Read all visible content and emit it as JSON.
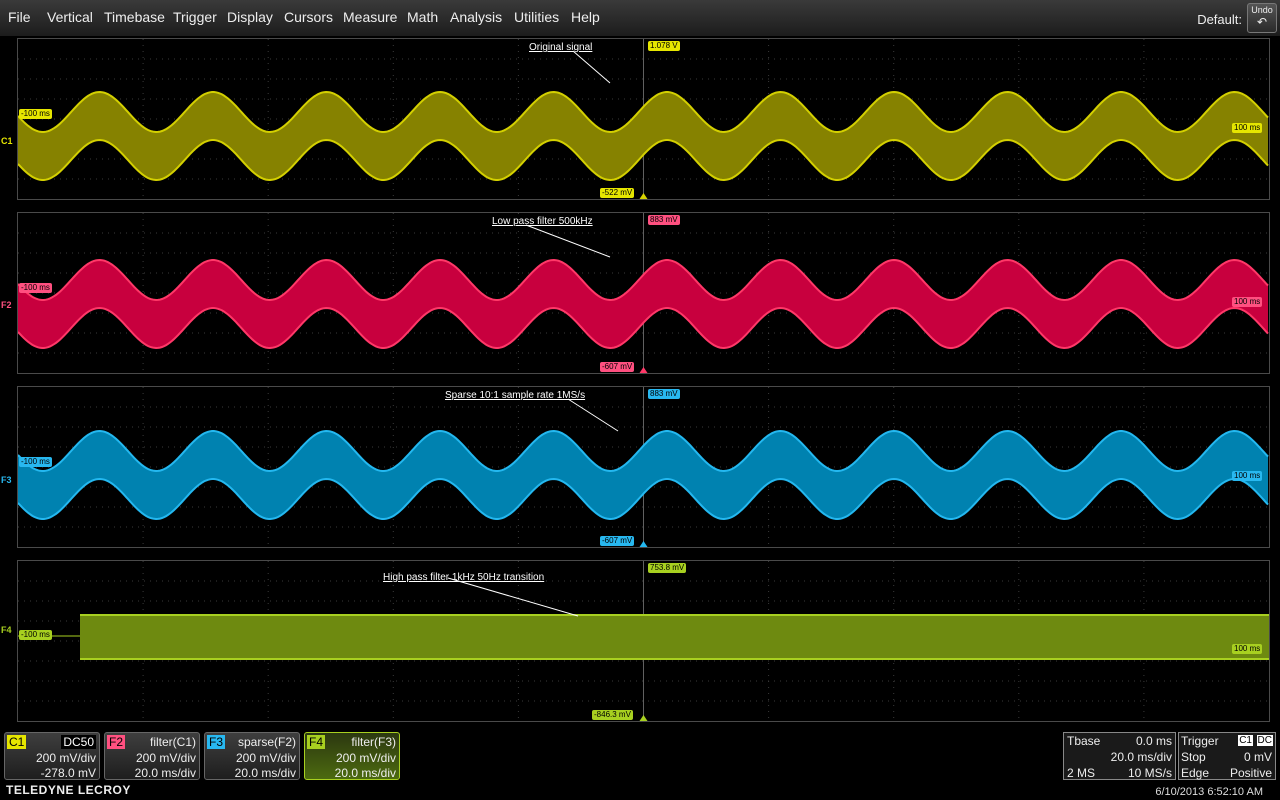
{
  "menu": {
    "items": [
      "File",
      "Vertical",
      "Timebase",
      "Trigger",
      "Display",
      "Cursors",
      "Measure",
      "Math",
      "Analysis",
      "Utilities",
      "Help"
    ],
    "default_label": "Default:",
    "undo_label": "Undo",
    "undo_icon": "undo-arrow-icon"
  },
  "traces": [
    {
      "id": "C1",
      "title": "Original signal",
      "top_value": "1.078 V",
      "bottom_value": "-522 mV",
      "left_time": "-100 ms",
      "right_time": "100 ms",
      "color": "#d4d000",
      "fill": "#868200"
    },
    {
      "id": "F2",
      "title": "Low pass filter 500kHz",
      "top_value": "883 mV",
      "bottom_value": "-607 mV",
      "left_time": "-100 ms",
      "right_time": "100 ms",
      "color": "#ff3868",
      "fill": "#c8003e"
    },
    {
      "id": "F3",
      "title": "Sparse 10:1 sample rate 1MS/s",
      "top_value": "883 mV",
      "bottom_value": "-607 mV",
      "left_time": "-100 ms",
      "right_time": "100 ms",
      "color": "#24b8f0",
      "fill": "#0082b0"
    },
    {
      "id": "F4",
      "title": "High pass filter 1kHz 50Hz transition",
      "top_value": "753.8 mV",
      "bottom_value": "-846.3 mV",
      "left_time": "-100 ms",
      "right_time": "100 ms",
      "color": "#a8d020",
      "fill": "#6e8a10"
    }
  ],
  "descriptors": [
    {
      "id": "C1",
      "func": "DC50",
      "scale": "200 mV/div",
      "offset": "-278.0 mV",
      "color": "#e6e600"
    },
    {
      "id": "F2",
      "func": "filter(C1)",
      "scale": "200 mV/div",
      "offset": "20.0 ms/div",
      "color": "#ff5080"
    },
    {
      "id": "F3",
      "func": "sparse(F2)",
      "scale": "200 mV/div",
      "offset": "20.0 ms/div",
      "color": "#28b8f0"
    },
    {
      "id": "F4",
      "func": "filter(F3)",
      "scale": "200 mV/div",
      "offset": "20.0 ms/div",
      "color": "#a8d020"
    }
  ],
  "timebase": {
    "label": "Tbase",
    "delay": "0.0 ms",
    "scale": "20.0 ms/div",
    "samples": "2 MS",
    "rate": "10 MS/s"
  },
  "trigger": {
    "label": "Trigger",
    "source": "C1",
    "coupling": "DC",
    "mode": "Stop",
    "level": "0 mV",
    "type": "Edge",
    "slope": "Positive"
  },
  "brand": "TELEDYNE LECROY",
  "datetime": "6/10/2013 6:52:10 AM"
}
